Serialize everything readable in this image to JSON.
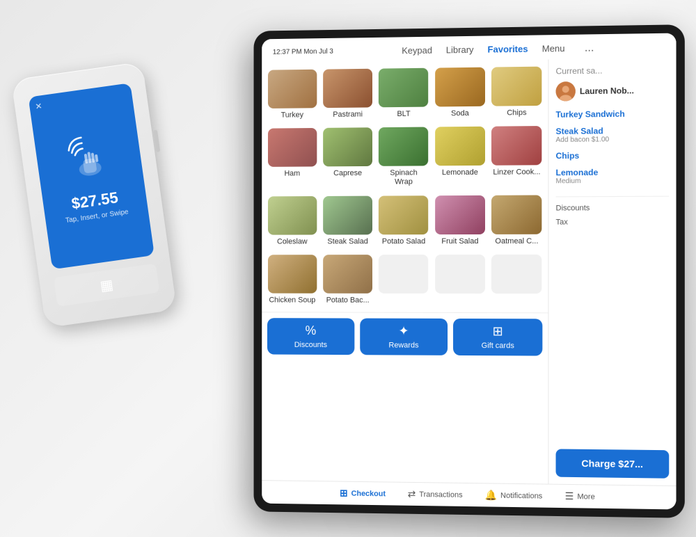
{
  "scene": {
    "background": "#eeeeed"
  },
  "reader": {
    "amount": "$27.55",
    "subtitle": "Tap, Insert, or Swipe",
    "close_label": "✕"
  },
  "tablet": {
    "time": "12:37 PM  Mon Jul 3",
    "nav": {
      "items": [
        {
          "label": "Keypad",
          "active": false
        },
        {
          "label": "Library",
          "active": false
        },
        {
          "label": "Favorites",
          "active": true
        },
        {
          "label": "Menu",
          "active": false
        }
      ],
      "more": "..."
    },
    "menu_items": [
      {
        "label": "Turkey",
        "food_class": "food-turkey"
      },
      {
        "label": "Pastrami",
        "food_class": "food-pastrami"
      },
      {
        "label": "BLT",
        "food_class": "food-blt"
      },
      {
        "label": "Soda",
        "food_class": "food-soda"
      },
      {
        "label": "Chips",
        "food_class": "food-chips"
      },
      {
        "label": "Ham",
        "food_class": "food-ham"
      },
      {
        "label": "Caprese",
        "food_class": "food-caprese"
      },
      {
        "label": "Spinach\nWrap",
        "food_class": "food-spinach"
      },
      {
        "label": "Lemonade",
        "food_class": "food-lemonade"
      },
      {
        "label": "Linzer Cook...",
        "food_class": "food-linzer"
      },
      {
        "label": "Coleslaw",
        "food_class": "food-coleslaw"
      },
      {
        "label": "Steak Salad",
        "food_class": "food-steak-salad"
      },
      {
        "label": "Potato Salad",
        "food_class": "food-potato-salad"
      },
      {
        "label": "Fruit Salad",
        "food_class": "food-fruit-salad"
      },
      {
        "label": "Oatmeal C...",
        "food_class": "food-oatmeal"
      },
      {
        "label": "Chicken Soup",
        "food_class": "food-chicken-soup"
      },
      {
        "label": "Potato Bac...",
        "food_class": "food-potato-bac"
      },
      {
        "label": "",
        "food_class": "food-empty"
      },
      {
        "label": "",
        "food_class": "food-empty"
      },
      {
        "label": "",
        "food_class": "food-empty"
      }
    ],
    "action_buttons": [
      {
        "label": "Discounts",
        "icon": "%"
      },
      {
        "label": "Rewards",
        "icon": "✦"
      },
      {
        "label": "Gift cards",
        "icon": "⊞"
      }
    ],
    "sale": {
      "title": "Current sa...",
      "customer_name": "Lauren Nob...",
      "items": [
        {
          "name": "Turkey Sandwich",
          "sub": ""
        },
        {
          "name": "Steak Salad",
          "sub": "Add bacon $1.00"
        },
        {
          "name": "Chips",
          "sub": ""
        },
        {
          "name": "Lemonade",
          "sub": "Medium"
        }
      ],
      "discounts_label": "Discounts",
      "tax_label": "Tax",
      "charge_label": "Charge $27..."
    },
    "bottom_nav": [
      {
        "label": "Checkout",
        "icon": "⊞",
        "active": true
      },
      {
        "label": "Transactions",
        "icon": "⇄",
        "active": false
      },
      {
        "label": "Notifications",
        "icon": "🔔",
        "active": false
      },
      {
        "label": "More",
        "icon": "☰",
        "active": false
      }
    ]
  }
}
